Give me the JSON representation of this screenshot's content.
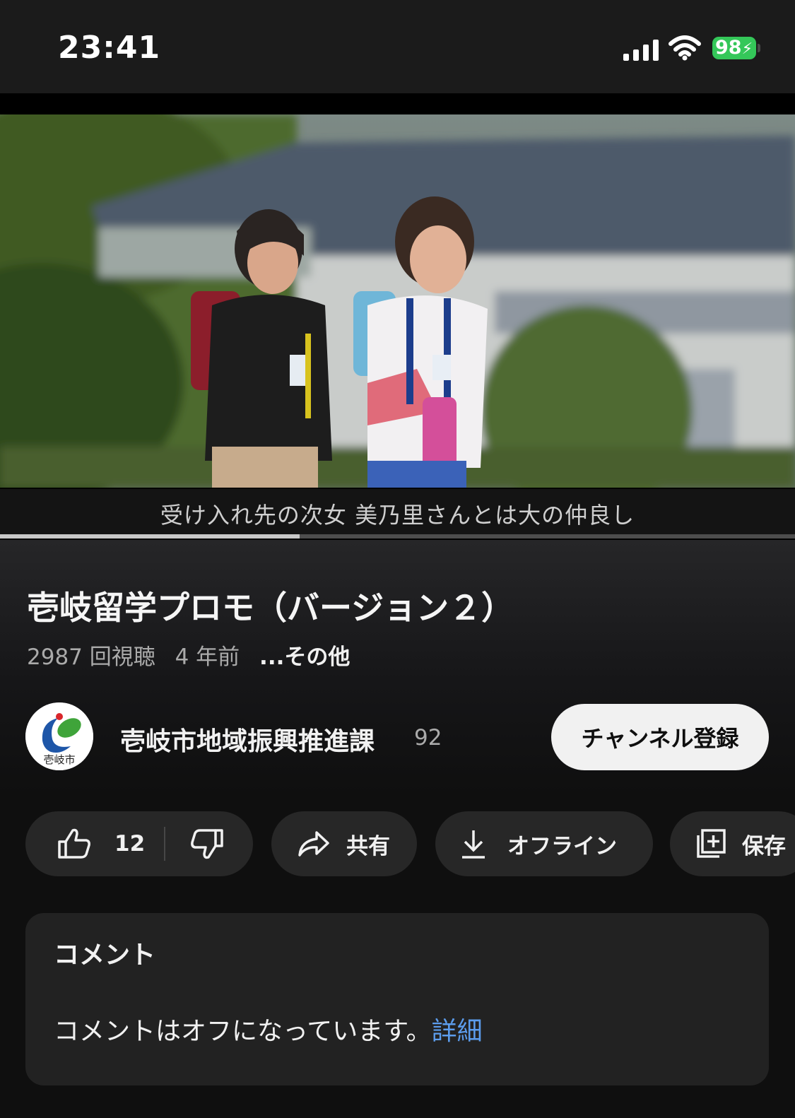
{
  "status_bar": {
    "time": "23:41",
    "battery": "98",
    "icons": [
      "cellular-signal-icon",
      "wifi-icon",
      "battery-charging-icon"
    ]
  },
  "player": {
    "caption": "受け入れ先の次女 美乃里さんとは大の仲良し",
    "progress_fraction": 0.377
  },
  "video": {
    "title": "壱岐留学プロモ（バージョン２）",
    "views": "2987 回視聴",
    "age": "4 年前",
    "more": "...その他"
  },
  "channel": {
    "name": "壱岐市地域振興推進課",
    "subscribers": "92",
    "avatar_text": "壱岐市",
    "subscribe_label": "チャンネル登録"
  },
  "actions": {
    "like_count": "12",
    "share_label": "共有",
    "offline_label": "オフライン",
    "save_label": "保存",
    "icons": [
      "thumbs-up-icon",
      "thumbs-down-icon",
      "share-arrow-icon",
      "download-icon",
      "add-to-playlist-icon"
    ]
  },
  "comments": {
    "title": "コメント",
    "off_message": "コメントはオフになっています。",
    "details_link": "詳細"
  },
  "colors": {
    "background": "#0f0f0f",
    "chip": "#272727",
    "link": "#5c9ded",
    "battery": "#34c759"
  }
}
